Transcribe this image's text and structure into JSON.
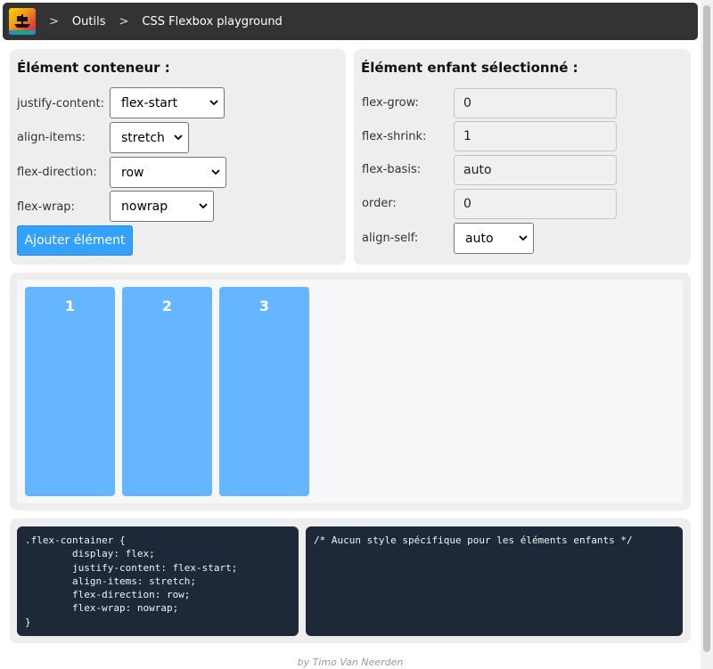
{
  "header": {
    "logo_icon": "pirate-ship-logo-icon",
    "crumb_sep": ">",
    "crumbs": [
      "Outils",
      "CSS Flexbox playground"
    ]
  },
  "container_panel": {
    "title": "Élément conteneur :",
    "justify_label": "justify-content:",
    "justify_value": "flex-start",
    "align_label": "align-items:",
    "align_value": "stretch",
    "direction_label": "flex-direction:",
    "direction_value": "row",
    "wrap_label": "flex-wrap:",
    "wrap_value": "nowrap",
    "add_button": "Ajouter élément"
  },
  "child_panel": {
    "title": "Élément enfant sélectionné :",
    "grow_label": "flex-grow:",
    "grow_value": "0",
    "shrink_label": "flex-shrink:",
    "shrink_value": "1",
    "basis_label": "flex-basis:",
    "basis_value": "auto",
    "order_label": "order:",
    "order_value": "0",
    "alignself_label": "align-self:",
    "alignself_value": "auto"
  },
  "flex_items": [
    "1",
    "2",
    "3"
  ],
  "code": {
    "container_css": ".flex-container {\n        display: flex;\n        justify-content: flex-start;\n        align-items: stretch;\n        flex-direction: row;\n        flex-wrap: nowrap;\n}",
    "children_css": "/* Aucun style spécifique pour les éléments enfants */"
  },
  "footer": {
    "prefix": "by ",
    "author": "Timo Van Neerden"
  },
  "colors": {
    "header_bg": "#333333",
    "panel_bg": "#eeeeee",
    "accent_button": "#33a1fd",
    "flex_item": "#66b6ff",
    "code_bg": "#1d2939"
  }
}
